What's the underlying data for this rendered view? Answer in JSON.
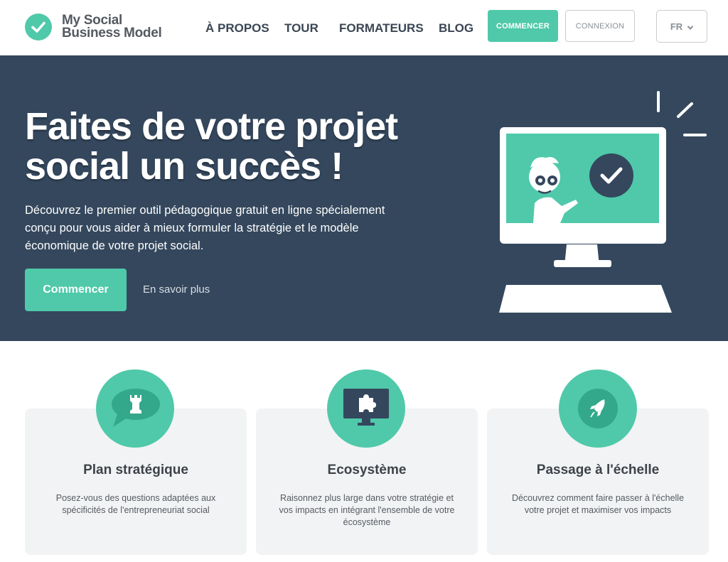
{
  "brand": {
    "line1": "My Social",
    "line2": "Business Model"
  },
  "nav": {
    "items": [
      "À PROPOS",
      "TOUR",
      "FORMATEURS",
      "BLOG"
    ],
    "start_label": "COMMENCER",
    "login_label": "CONNEXION",
    "lang": "FR"
  },
  "hero": {
    "title": "Faites de votre projet social un succès !",
    "subtitle": "Découvrez le premier outil pédagogique gratuit en ligne spécialement conçu pour vous aider à mieux formuler la stratégie et le modèle économique de votre projet social.",
    "cta_label": "Commencer",
    "learn_more_label": "En savoir plus"
  },
  "features": [
    {
      "icon": "rook-speech-icon",
      "title": "Plan stratégique",
      "text": "Posez-vous des questions adaptées aux spécificités de l'entrepreneuriat social"
    },
    {
      "icon": "puzzle-monitor-icon",
      "title": "Ecosystème",
      "text": "Raisonnez plus large dans votre stratégie et vos impacts en intégrant l'ensemble de votre écosystème"
    },
    {
      "icon": "rocket-icon",
      "title": "Passage à l'échelle",
      "text": "Découvrez comment faire passer à l'échelle votre projet et maximiser vos impacts"
    }
  ],
  "colors": {
    "accent": "#4fc9a9",
    "hero_bg": "#34475d",
    "card_bg": "#f2f3f4"
  }
}
